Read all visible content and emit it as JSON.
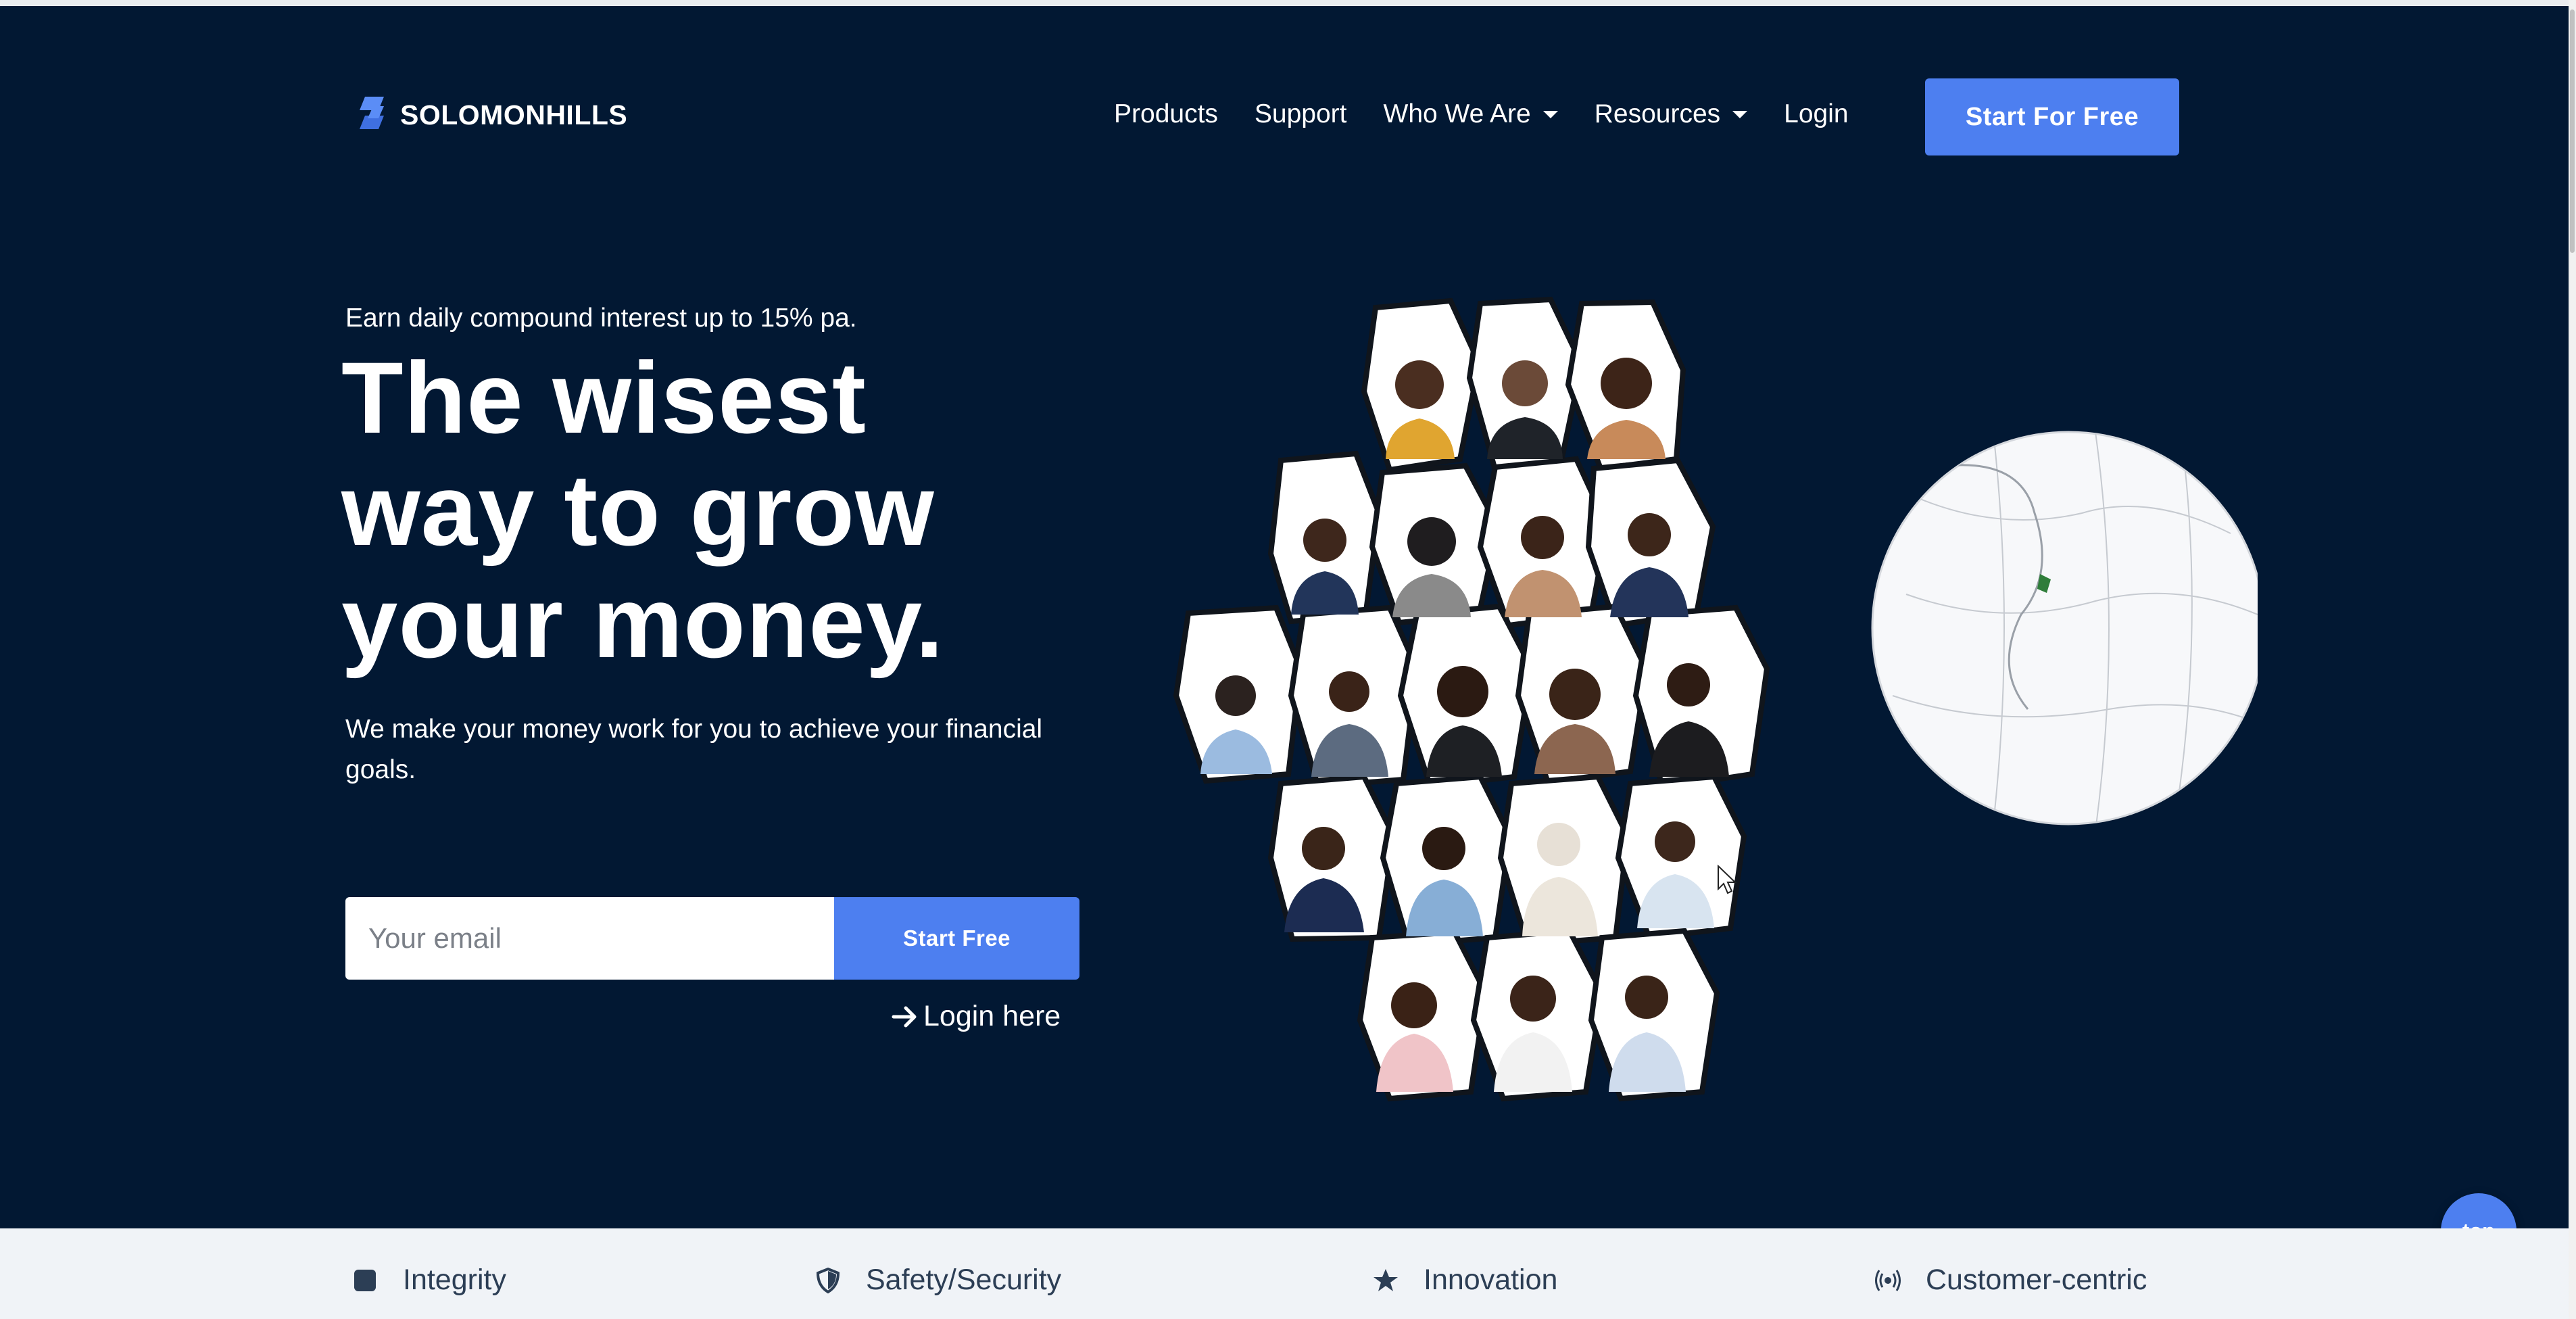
{
  "header": {
    "brand": "SOLOMONHILLS",
    "nav": {
      "products": "Products",
      "support": "Support",
      "who_we_are": "Who We Are",
      "resources": "Resources",
      "login": "Login"
    },
    "cta_label": "Start For Free"
  },
  "hero": {
    "kicker": "Earn daily compound interest up to 15% pa.",
    "headline_lines": [
      "The wisest",
      "way to grow",
      "your money."
    ],
    "subtext": "We make your money work for you to achieve your financial goals.",
    "email_placeholder": "Your email",
    "start_free_label": "Start Free",
    "login_here": "Login here"
  },
  "illustration": {
    "description_icon": "hexagon-people-collage",
    "globe_icon": "globe-icon"
  },
  "top_button": "top",
  "values": [
    {
      "label": "Integrity",
      "icon": "square-icon"
    },
    {
      "label": "Safety/Security",
      "icon": "shield-icon"
    },
    {
      "label": "Innovation",
      "icon": "star-icon"
    },
    {
      "label": "Customer-centric",
      "icon": "signal-icon"
    }
  ],
  "colors": {
    "hero_bg": "#021833",
    "accent": "#4d7ff0",
    "strip_bg": "#f0f3f7",
    "strip_text": "#2c3e55"
  }
}
